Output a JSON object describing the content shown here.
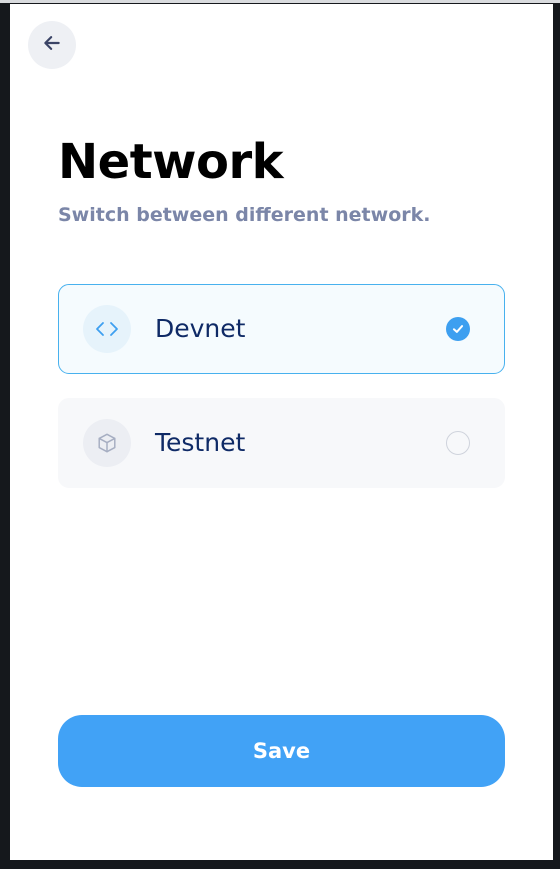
{
  "header": {
    "back_icon": "arrow-left-icon"
  },
  "page": {
    "title": "Network",
    "subtitle": "Switch between different network."
  },
  "networks": [
    {
      "label": "Devnet",
      "icon": "code-brackets-icon",
      "selected": true
    },
    {
      "label": "Testnet",
      "icon": "cube-icon",
      "selected": false
    }
  ],
  "actions": {
    "save_label": "Save"
  },
  "colors": {
    "accent": "#41a2f6",
    "selected_border": "#48b1ee",
    "label": "#0f2a66",
    "subtitle": "#7b86a8"
  }
}
